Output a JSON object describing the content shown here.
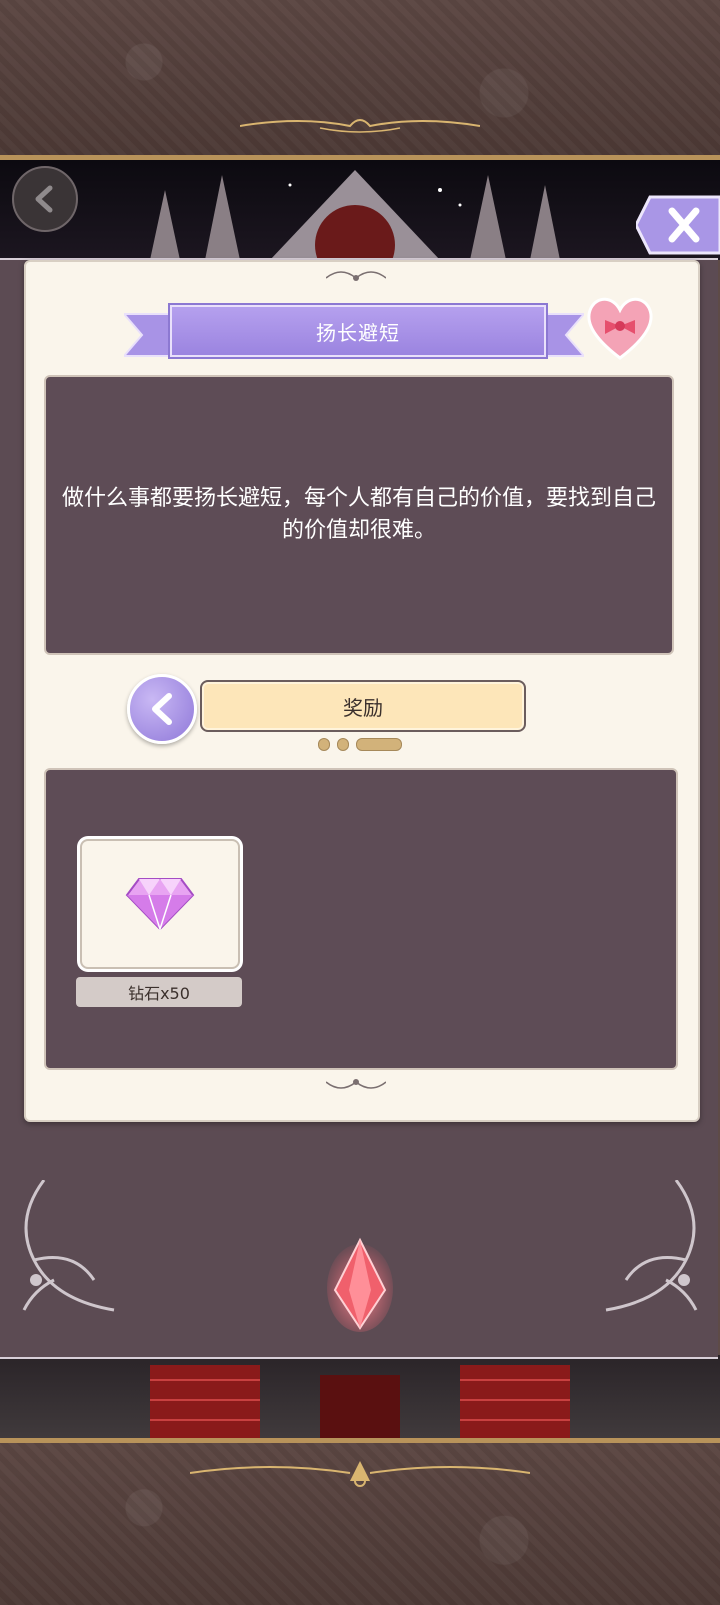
{
  "header": {
    "back_icon": "chevron-left-icon",
    "close_icon": "close-x-icon"
  },
  "title": "扬长避短",
  "description": "做什么事都要扬长避短，每个人都有自己的价值，要找到自己的价值却很难。",
  "tab_label": "奖励",
  "page_indicator": {
    "pages": 3,
    "active": 3
  },
  "rewards": [
    {
      "icon": "diamond-icon",
      "label": "钻石x50"
    }
  ],
  "colors": {
    "accent_purple": "#9b84e0",
    "panel": "#5e4c56",
    "card": "#faf5eb",
    "tab": "#fde6b9"
  }
}
